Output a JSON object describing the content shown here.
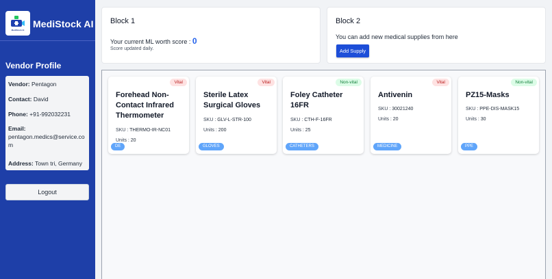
{
  "app": {
    "name": "MediStock AI",
    "logo_caption": "MediStock AI"
  },
  "sidebar": {
    "heading": "Vendor Profile",
    "profile": [
      {
        "label": "Vendor:",
        "value": " Pentagon"
      },
      {
        "label": "Contact:",
        "value": " David"
      },
      {
        "label": "Phone:",
        "value": " +91-992032231"
      },
      {
        "label": "Email:",
        "value": "pentagon.medics@service.com"
      },
      {
        "label": "Address:",
        "value": " Town tri, Germany"
      }
    ],
    "logout_label": "Logout"
  },
  "block1": {
    "title": "Block 1",
    "text": "Your current ML worth score : ",
    "score": "0",
    "subtext": "Score updated daily."
  },
  "block2": {
    "title": "Block 2",
    "text": "You can add new medical supplies from here",
    "button_label": "Add Supply"
  },
  "sku_label": "SKU :",
  "units_label": "Units :",
  "products": [
    {
      "title": "Forehead Non-Contact Infrared Thermometer",
      "status": "Vital",
      "sku": " THERMO-IR-NC01",
      "units": " 20",
      "category": "DE"
    },
    {
      "title": "Sterile Latex Surgical Gloves",
      "status": "Vital",
      "sku": " GLV-L-STR-100",
      "units": " 200",
      "category": "GLOVES"
    },
    {
      "title": "Foley Catheter 16FR",
      "status": "Non-vital",
      "sku": " CTH-F-16FR",
      "units": " 25",
      "category": "CATHETERS"
    },
    {
      "title": "Antivenin",
      "status": "Vital",
      "sku": " 30021240",
      "units": " 20",
      "category": "MEDICINE"
    },
    {
      "title": "PZ15-Masks",
      "status": "Non-vital",
      "sku": " PPE-DIS-MASK15",
      "units": " 30",
      "category": "PPE"
    }
  ],
  "colors": {
    "sidebar": "#1e3fa8",
    "accent": "#1d4ed8",
    "score": "#2563eb",
    "vital_bg": "#fee2e2",
    "vital_text": "#b91c1c",
    "nonvital_bg": "#dcfce7",
    "nonvital_text": "#15803d",
    "tag": "#60a5fa"
  }
}
